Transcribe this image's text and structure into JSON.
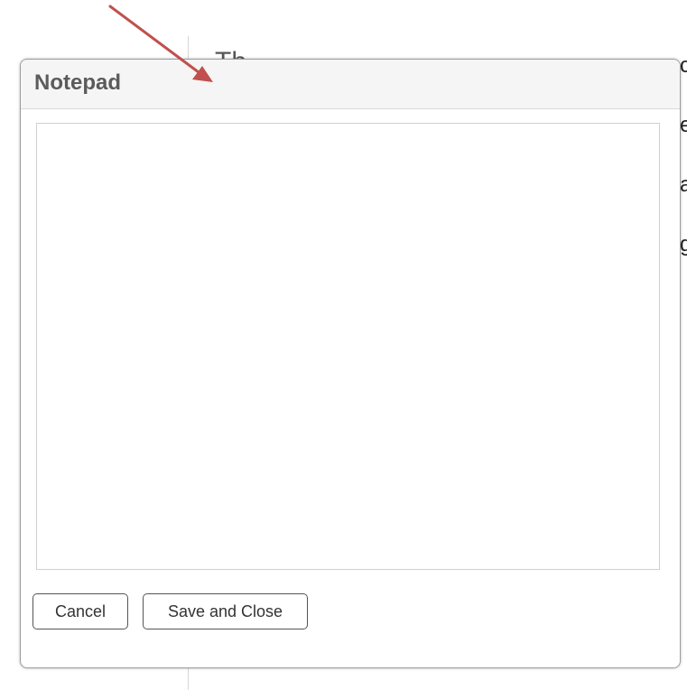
{
  "background": {
    "visible_text": "Th",
    "edge_fragments": [
      "c",
      "e",
      "a",
      "g"
    ]
  },
  "dialog": {
    "title": "Notepad",
    "notes_value": "",
    "buttons": {
      "cancel_label": "Cancel",
      "save_label": "Save and Close"
    }
  },
  "annotation": {
    "icon": "arrow-icon",
    "color": "#c0504d"
  }
}
